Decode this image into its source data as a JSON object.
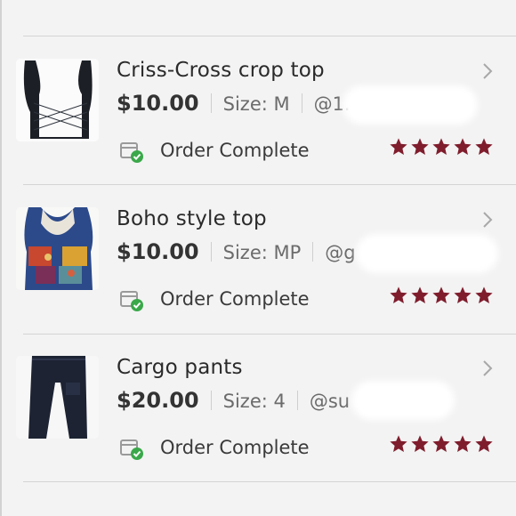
{
  "orders": [
    {
      "title": "Criss-Cross crop top",
      "price": "$10.00",
      "size": "Size: M",
      "seller": "@1.",
      "status": "Order Complete",
      "rating": 5,
      "image": "black-crop-top-photo"
    },
    {
      "title": "Boho style top",
      "price": "$10.00",
      "size": "Size: MP",
      "seller": "@g",
      "status": "Order Complete",
      "rating": 5,
      "image": "boho-patterned-top-photo"
    },
    {
      "title": "Cargo pants",
      "price": "$20.00",
      "size": "Size: 4",
      "seller": "@su",
      "status": "Order Complete",
      "rating": 5,
      "image": "navy-cargo-pants-photo"
    }
  ],
  "colors": {
    "star": "#7f1d2d",
    "check": "#3aa84a",
    "chevron": "#a8a8a8",
    "background": "#f3f3f3"
  },
  "icons": {
    "status": "package-check-icon",
    "next": "chevron-right-icon",
    "rating": "star-icon"
  }
}
